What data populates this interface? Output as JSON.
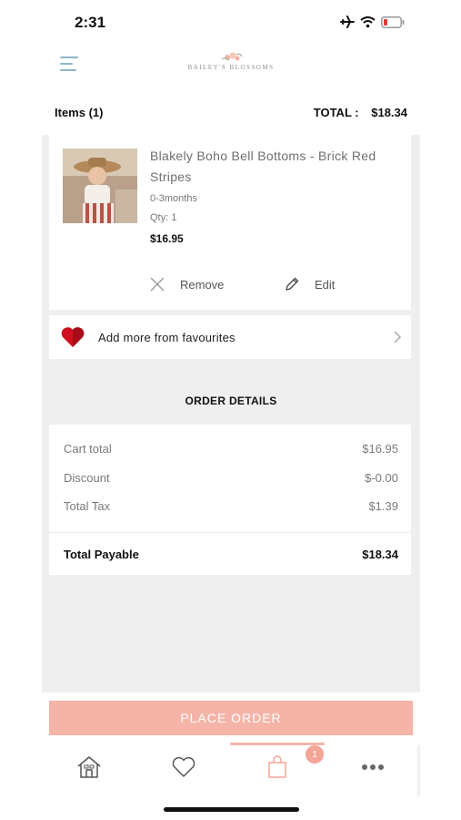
{
  "status_bar": {
    "time": "2:31"
  },
  "header": {
    "logo_text": "BAILEY'S BLOSSOMS"
  },
  "summary": {
    "items_label": "Items (1)",
    "total_label": "TOTAL :",
    "total_value": "$18.34"
  },
  "cart_item": {
    "name": "Blakely Boho Bell Bottoms - Brick Red Stripes",
    "variant": "0-3months",
    "qty": "Qty:  1",
    "price": "$16.95",
    "remove_label": "Remove",
    "edit_label": "Edit"
  },
  "favourites": {
    "label": "Add more from favourites"
  },
  "order_details": {
    "title": "ORDER DETAILS",
    "lines": [
      {
        "label": "Cart total",
        "value": "$16.95"
      },
      {
        "label": "Discount",
        "value": "$-0.00"
      },
      {
        "label": "Total Tax",
        "value": "$1.39"
      }
    ],
    "payable_label": "Total Payable",
    "payable_value": "$18.34"
  },
  "place_order_label": "PLACE ORDER",
  "tab_bar": {
    "tabs": [
      {
        "icon": "home-icon"
      },
      {
        "icon": "heart-icon"
      },
      {
        "icon": "shopping-bag-icon",
        "active": true
      },
      {
        "icon": "more-icon"
      }
    ],
    "cart_badge": "1"
  },
  "colors": {
    "accent": "#f4b5a8",
    "badge": "#f4a598",
    "background": "#efefef",
    "heart": "#d0101e"
  }
}
